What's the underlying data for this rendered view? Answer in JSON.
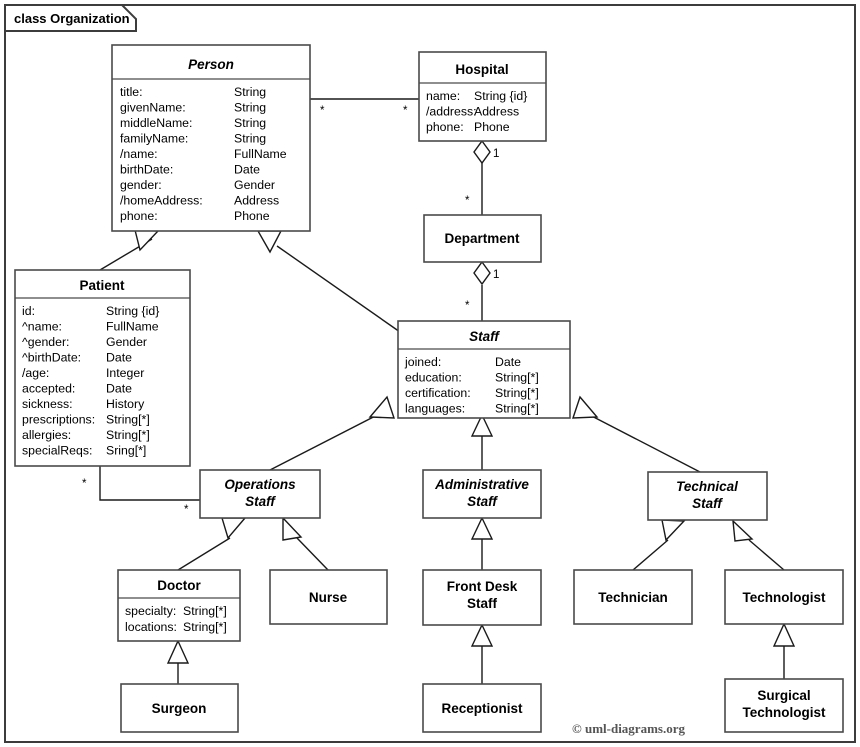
{
  "frame": {
    "label": "class Organization",
    "copyright": "© uml-diagrams.org"
  },
  "classes": {
    "person": {
      "name": "Person",
      "abstract": true,
      "attributes": [
        {
          "name": "title:",
          "type": "String"
        },
        {
          "name": "givenName:",
          "type": "String"
        },
        {
          "name": "middleName:",
          "type": "String"
        },
        {
          "name": "familyName:",
          "type": "String"
        },
        {
          "name": "/name:",
          "type": "FullName"
        },
        {
          "name": "birthDate:",
          "type": "Date"
        },
        {
          "name": "gender:",
          "type": "Gender"
        },
        {
          "name": "/homeAddress:",
          "type": "Address"
        },
        {
          "name": "phone:",
          "type": "Phone"
        }
      ]
    },
    "hospital": {
      "name": "Hospital",
      "abstract": false,
      "attributes": [
        {
          "name": "name:",
          "type": "String {id}"
        },
        {
          "name": "/address:",
          "type": "Address"
        },
        {
          "name": "phone:",
          "type": "Phone"
        }
      ]
    },
    "department": {
      "name": "Department",
      "abstract": false,
      "attributes": []
    },
    "patient": {
      "name": "Patient",
      "abstract": false,
      "attributes": [
        {
          "name": "id:",
          "type": "String {id}"
        },
        {
          "name": "^name:",
          "type": "FullName"
        },
        {
          "name": "^gender:",
          "type": "Gender"
        },
        {
          "name": "^birthDate:",
          "type": "Date"
        },
        {
          "name": "/age:",
          "type": "Integer"
        },
        {
          "name": "accepted:",
          "type": "Date"
        },
        {
          "name": "sickness:",
          "type": "History"
        },
        {
          "name": "prescriptions:",
          "type": "String[*]"
        },
        {
          "name": "allergies:",
          "type": "String[*]"
        },
        {
          "name": "specialReqs:",
          "type": "Sring[*]"
        }
      ]
    },
    "staff": {
      "name": "Staff",
      "abstract": true,
      "attributes": [
        {
          "name": "joined:",
          "type": "Date"
        },
        {
          "name": "education:",
          "type": "String[*]"
        },
        {
          "name": "certification:",
          "type": "String[*]"
        },
        {
          "name": "languages:",
          "type": "String[*]"
        }
      ]
    },
    "operations_staff": {
      "name": "Operations Staff",
      "line1": "Operations",
      "line2": "Staff",
      "abstract": true,
      "attributes": []
    },
    "administrative_staff": {
      "name": "Administrative Staff",
      "line1": "Administrative",
      "line2": "Staff",
      "abstract": true,
      "attributes": []
    },
    "technical_staff": {
      "name": "Technical Staff",
      "line1": "Technical",
      "line2": "Staff",
      "abstract": true,
      "attributes": []
    },
    "doctor": {
      "name": "Doctor",
      "abstract": false,
      "attributes": [
        {
          "name": "specialty:",
          "type": "String[*]"
        },
        {
          "name": "locations:",
          "type": "String[*]"
        }
      ]
    },
    "nurse": {
      "name": "Nurse",
      "abstract": false,
      "attributes": []
    },
    "front_desk_staff": {
      "name": "Front Desk Staff",
      "line1": "Front Desk",
      "line2": "Staff",
      "abstract": false,
      "attributes": []
    },
    "technician": {
      "name": "Technician",
      "abstract": false,
      "attributes": []
    },
    "technologist": {
      "name": "Technologist",
      "abstract": false,
      "attributes": []
    },
    "surgeon": {
      "name": "Surgeon",
      "abstract": false,
      "attributes": []
    },
    "receptionist": {
      "name": "Receptionist",
      "abstract": false,
      "attributes": []
    },
    "surgical_technologist": {
      "name": "Surgical Technologist",
      "line1": "Surgical",
      "line2": "Technologist",
      "abstract": false,
      "attributes": []
    }
  },
  "multiplicities": {
    "person_to_hospital_source": "*",
    "person_to_hospital_target": "*",
    "hospital_to_department_whole": "1",
    "hospital_to_department_part": "*",
    "department_to_staff_whole": "1",
    "department_to_staff_part": "*",
    "patient_to_operations_source": "*",
    "patient_to_operations_target": "*"
  },
  "colors": {
    "frame_stroke": "#3c3c3c",
    "box_stroke": "#4a4a4a",
    "line_stroke": "#1a1a1a",
    "background": "#ffffff",
    "copyright_fill": "#555555"
  }
}
